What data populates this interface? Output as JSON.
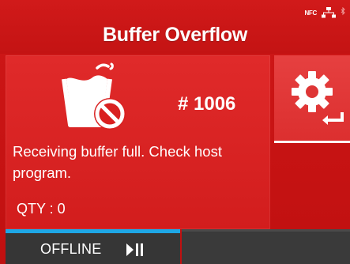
{
  "header": {
    "title": "Buffer Overflow",
    "status": {
      "nfc_label": "NFC"
    }
  },
  "error": {
    "code": "# 1006",
    "message": "Receiving buffer full. Check host program.",
    "qty_label": "QTY : 0"
  },
  "footer": {
    "mode_label": "OFFLINE",
    "progress": 1.0
  },
  "colors": {
    "background": "#c41313",
    "panel": "#dc2626",
    "accent_bar": "#1ea7e6",
    "footer": "#363636"
  },
  "icons": {
    "status": [
      "nfc-icon",
      "network-icon",
      "bluetooth-icon"
    ],
    "panel": "buffer-overflow-icon",
    "settings": [
      "gear-icon",
      "enter-arrow-icon"
    ],
    "footer": "play-pause-icon"
  }
}
